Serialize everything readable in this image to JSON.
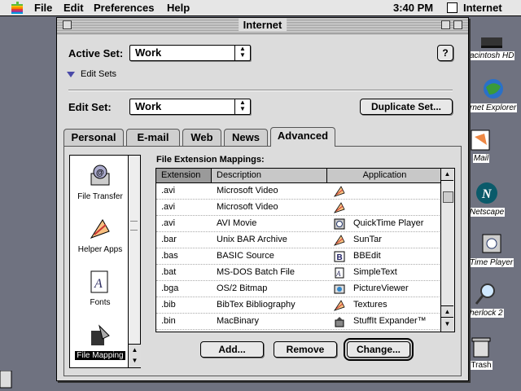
{
  "menubar": {
    "items": [
      "File",
      "Edit",
      "Preferences",
      "Help"
    ],
    "clock": "3:40 PM",
    "app": "Internet"
  },
  "desktop": [
    "acintosh HD",
    "rnet Explorer",
    "Mail",
    "Netscape",
    "Time Player",
    "herlock 2",
    "Trash"
  ],
  "window": {
    "title": "Internet",
    "active_set_label": "Active Set:",
    "active_set_value": "Work",
    "edit_sets_label": "Edit Sets",
    "edit_set_label": "Edit Set:",
    "edit_set_value": "Work",
    "duplicate_button": "Duplicate Set...",
    "help_icon": "?",
    "tabs": [
      "Personal",
      "E-mail",
      "Web",
      "News",
      "Advanced"
    ],
    "active_tab": "Advanced"
  },
  "sidebar": {
    "items": [
      {
        "label": "File Transfer",
        "icon": "file-transfer-icon"
      },
      {
        "label": "Helper Apps",
        "icon": "helper-apps-icon"
      },
      {
        "label": "Fonts",
        "icon": "fonts-icon"
      },
      {
        "label": "File Mapping",
        "icon": "file-mapping-icon",
        "selected": true
      }
    ]
  },
  "mappings": {
    "title": "File Extension Mappings:",
    "columns": [
      "Extension",
      "Description",
      "Application"
    ],
    "rows": [
      {
        "ext": ".avi",
        "desc": "Microsoft Video",
        "app": "",
        "icon": "generic-app-icon"
      },
      {
        "ext": ".avi",
        "desc": "Microsoft Video",
        "app": "",
        "icon": "generic-app-icon"
      },
      {
        "ext": ".avi",
        "desc": "AVI Movie",
        "app": "QuickTime Player",
        "icon": "quicktime-icon"
      },
      {
        "ext": ".bar",
        "desc": "Unix BAR Archive",
        "app": "SunTar",
        "icon": "generic-app-icon"
      },
      {
        "ext": ".bas",
        "desc": "BASIC Source",
        "app": "BBEdit",
        "icon": "bbedit-icon"
      },
      {
        "ext": ".bat",
        "desc": "MS-DOS Batch File",
        "app": "SimpleText",
        "icon": "simpletext-icon"
      },
      {
        "ext": ".bga",
        "desc": "OS/2 Bitmap",
        "app": "PictureViewer",
        "icon": "pictureviewer-icon"
      },
      {
        "ext": ".bib",
        "desc": "BibTex Bibliography",
        "app": "Textures",
        "icon": "generic-app-icon"
      },
      {
        "ext": ".bin",
        "desc": "MacBinary",
        "app": "StuffIt Expander™",
        "icon": "stuffit-icon"
      }
    ]
  },
  "buttons": {
    "add": "Add...",
    "remove": "Remove",
    "change": "Change..."
  },
  "colors": {
    "desktop": "#6f7280",
    "window": "#dcdcdc",
    "menubar": "#e6e6e6"
  }
}
